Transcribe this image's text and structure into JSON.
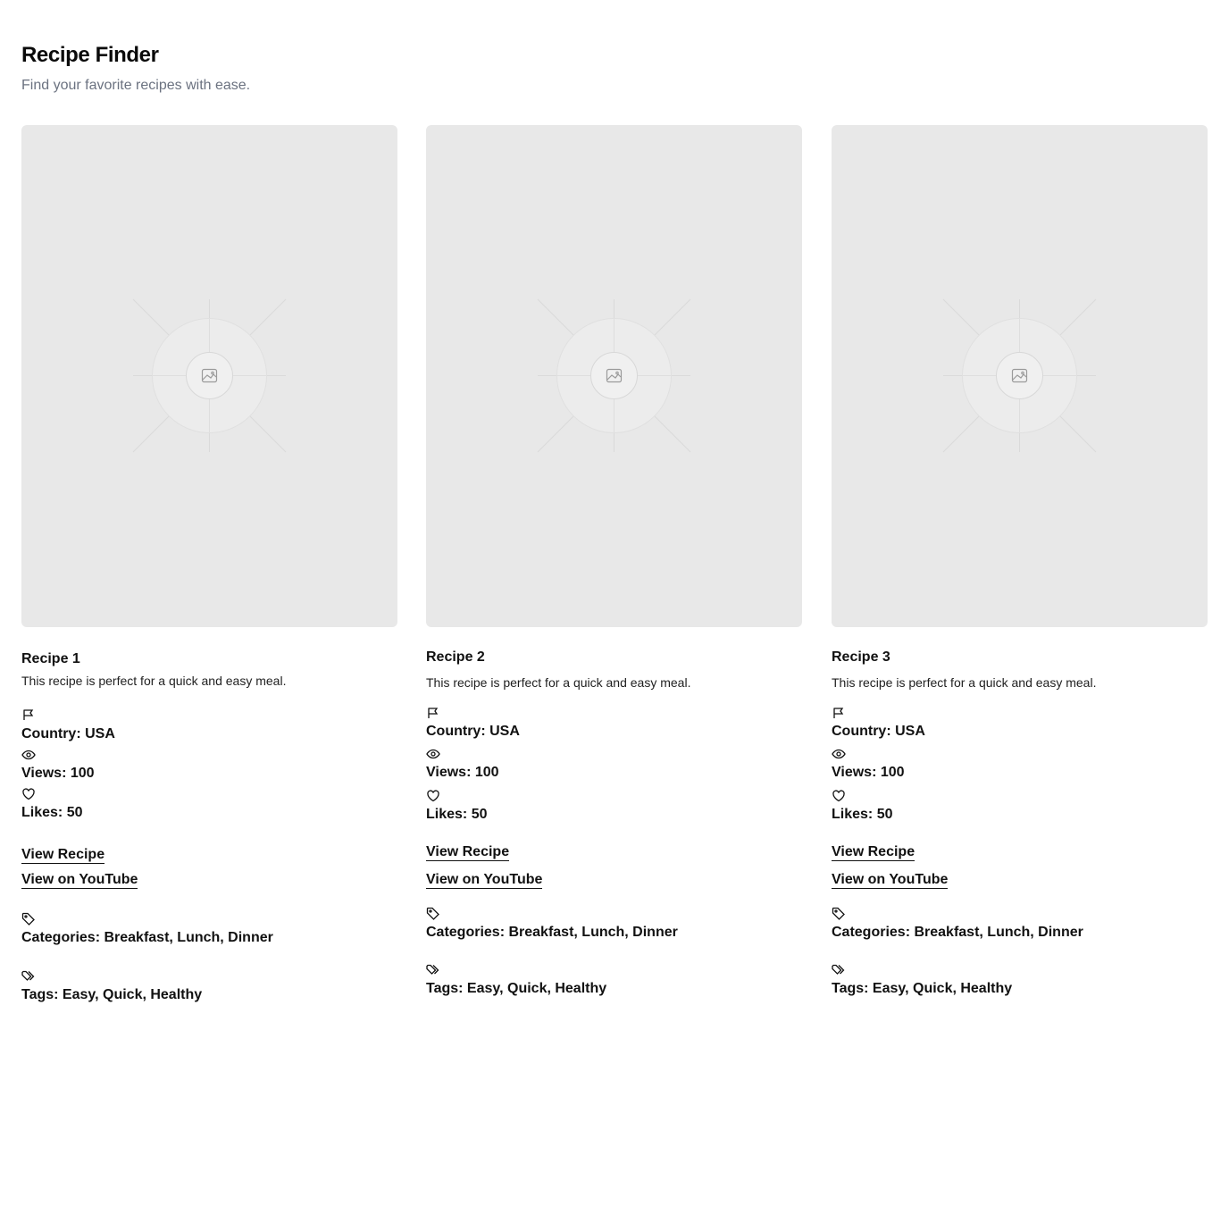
{
  "header": {
    "title": "Recipe Finder",
    "subtitle": "Find your favorite recipes with ease."
  },
  "icons": {
    "country": "flag-icon",
    "views": "eye-icon",
    "likes": "heart-icon",
    "categories": "tag-icon",
    "tags": "tags-icon",
    "image": "image-placeholder-icon"
  },
  "recipes": [
    {
      "name": "Recipe 1",
      "description": "This recipe is perfect for a quick and easy meal.",
      "country": "Country: USA",
      "views": "Views: 100",
      "likes": "Likes: 50",
      "view_recipe": "View Recipe",
      "view_youtube": "View on YouTube",
      "categories": "Categories: Breakfast, Lunch, Dinner",
      "tags": "Tags: Easy, Quick, Healthy"
    },
    {
      "name": "Recipe 2",
      "description": "This recipe is perfect for a quick and easy meal.",
      "country": "Country: USA",
      "views": "Views: 100",
      "likes": "Likes: 50",
      "view_recipe": "View Recipe",
      "view_youtube": "View on YouTube",
      "categories": "Categories: Breakfast, Lunch, Dinner",
      "tags": "Tags: Easy, Quick, Healthy"
    },
    {
      "name": "Recipe 3",
      "description": "This recipe is perfect for a quick and easy meal.",
      "country": "Country: USA",
      "views": "Views: 100",
      "likes": "Likes: 50",
      "view_recipe": "View Recipe",
      "view_youtube": "View on YouTube",
      "categories": "Categories: Breakfast, Lunch, Dinner",
      "tags": "Tags: Easy, Quick, Healthy"
    }
  ]
}
